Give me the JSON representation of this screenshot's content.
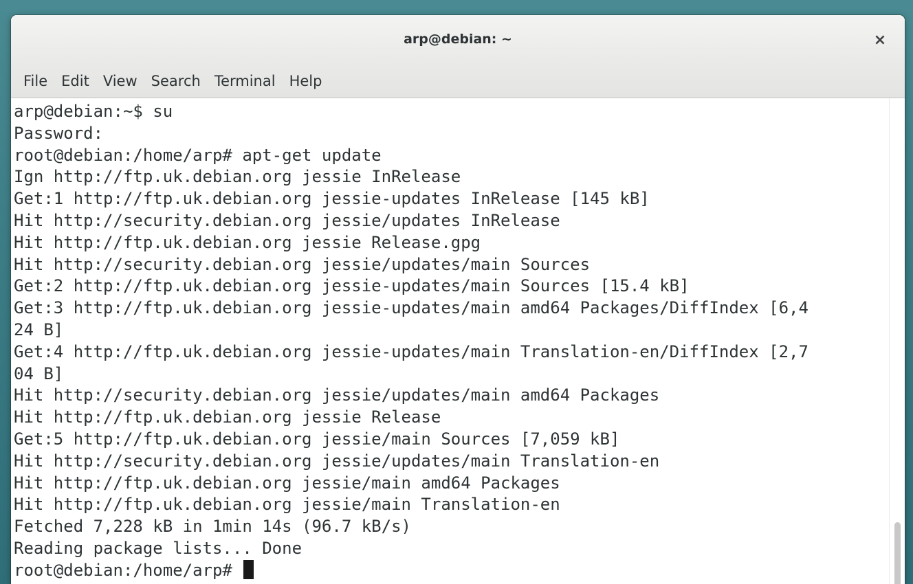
{
  "window": {
    "title": "arp@debian: ~",
    "close_symbol": "×"
  },
  "menu": [
    {
      "label": "File"
    },
    {
      "label": "Edit"
    },
    {
      "label": "View"
    },
    {
      "label": "Search"
    },
    {
      "label": "Terminal"
    },
    {
      "label": "Help"
    }
  ],
  "terminal": {
    "lines": [
      "arp@debian:~$ su",
      "Password:",
      "root@debian:/home/arp# apt-get update",
      "Ign http://ftp.uk.debian.org jessie InRelease",
      "Get:1 http://ftp.uk.debian.org jessie-updates InRelease [145 kB]",
      "Hit http://security.debian.org jessie/updates InRelease",
      "Hit http://ftp.uk.debian.org jessie Release.gpg",
      "Hit http://security.debian.org jessie/updates/main Sources",
      "Get:2 http://ftp.uk.debian.org jessie-updates/main Sources [15.4 kB]",
      "Get:3 http://ftp.uk.debian.org jessie-updates/main amd64 Packages/DiffIndex [6,4",
      "24 B]",
      "Get:4 http://ftp.uk.debian.org jessie-updates/main Translation-en/DiffIndex [2,7",
      "04 B]",
      "Hit http://security.debian.org jessie/updates/main amd64 Packages",
      "Hit http://ftp.uk.debian.org jessie Release",
      "Get:5 http://ftp.uk.debian.org jessie/main Sources [7,059 kB]",
      "Hit http://security.debian.org jessie/updates/main Translation-en",
      "Hit http://ftp.uk.debian.org jessie/main amd64 Packages",
      "Hit http://ftp.uk.debian.org jessie/main Translation-en",
      "Fetched 7,228 kB in 1min 14s (96.7 kB/s)",
      "Reading package lists... Done"
    ],
    "prompt": "root@debian:/home/arp# "
  },
  "icons": {
    "close": "close-icon",
    "cursor": "block-cursor"
  }
}
